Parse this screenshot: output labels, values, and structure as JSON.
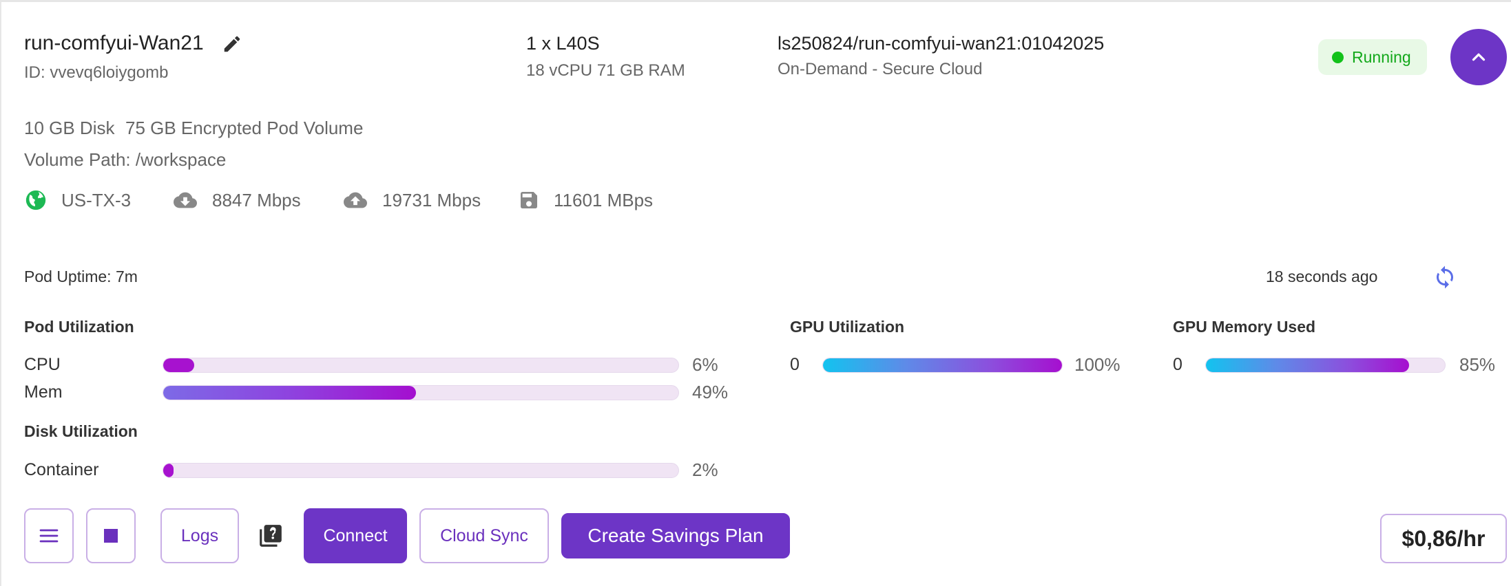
{
  "pod": {
    "name": "run-comfyui-Wan21",
    "id": "ID: vvevq6loiygomb",
    "gpu": "1 x L40S",
    "specs": "18 vCPU 71 GB RAM",
    "image": "ls250824/run-comfyui-wan21:01042025",
    "cloud": "On-Demand - Secure Cloud",
    "status": "Running",
    "disk": "10 GB Disk",
    "volume": "75 GB Encrypted Pod Volume",
    "volume_path": "Volume Path: /workspace",
    "region": "US-TX-3",
    "download": "8847 Mbps",
    "upload": "19731 Mbps",
    "disk_speed": "11601 MBps",
    "uptime": "Pod Uptime: 7m",
    "updated": "18 seconds ago",
    "price": "$0,86/hr"
  },
  "pod_utilization": {
    "title": "Pod Utilization",
    "cpu": {
      "label": "CPU",
      "value": 6,
      "text": "6%"
    },
    "mem": {
      "label": "Mem",
      "value": 49,
      "text": "49%"
    }
  },
  "disk_utilization": {
    "title": "Disk Utilization",
    "container": {
      "label": "Container",
      "value": 2,
      "text": "2%"
    }
  },
  "gpu_utilization": {
    "title": "GPU Utilization",
    "index": "0",
    "value": 100,
    "text": "100%"
  },
  "gpu_memory": {
    "title": "GPU Memory Used",
    "index": "0",
    "value": 85,
    "text": "85%"
  },
  "actions": {
    "logs": "Logs",
    "connect": "Connect",
    "cloud_sync": "Cloud Sync",
    "savings_plan": "Create Savings Plan"
  },
  "icons": {
    "edit": "pencil-icon",
    "status": "status-dot-icon",
    "collapse": "chevron-up-icon",
    "region": "globe-icon",
    "download": "cloud-download-icon",
    "upload": "cloud-upload-icon",
    "disk": "floppy-disk-icon",
    "refresh": "refresh-icon",
    "menu": "menu-icon",
    "stop": "stop-icon",
    "help": "help-library-icon"
  },
  "colors": {
    "accent": "#6d35c6",
    "running": "#12c21a",
    "running_bg": "#e8f9e6",
    "globe": "#1db954"
  }
}
